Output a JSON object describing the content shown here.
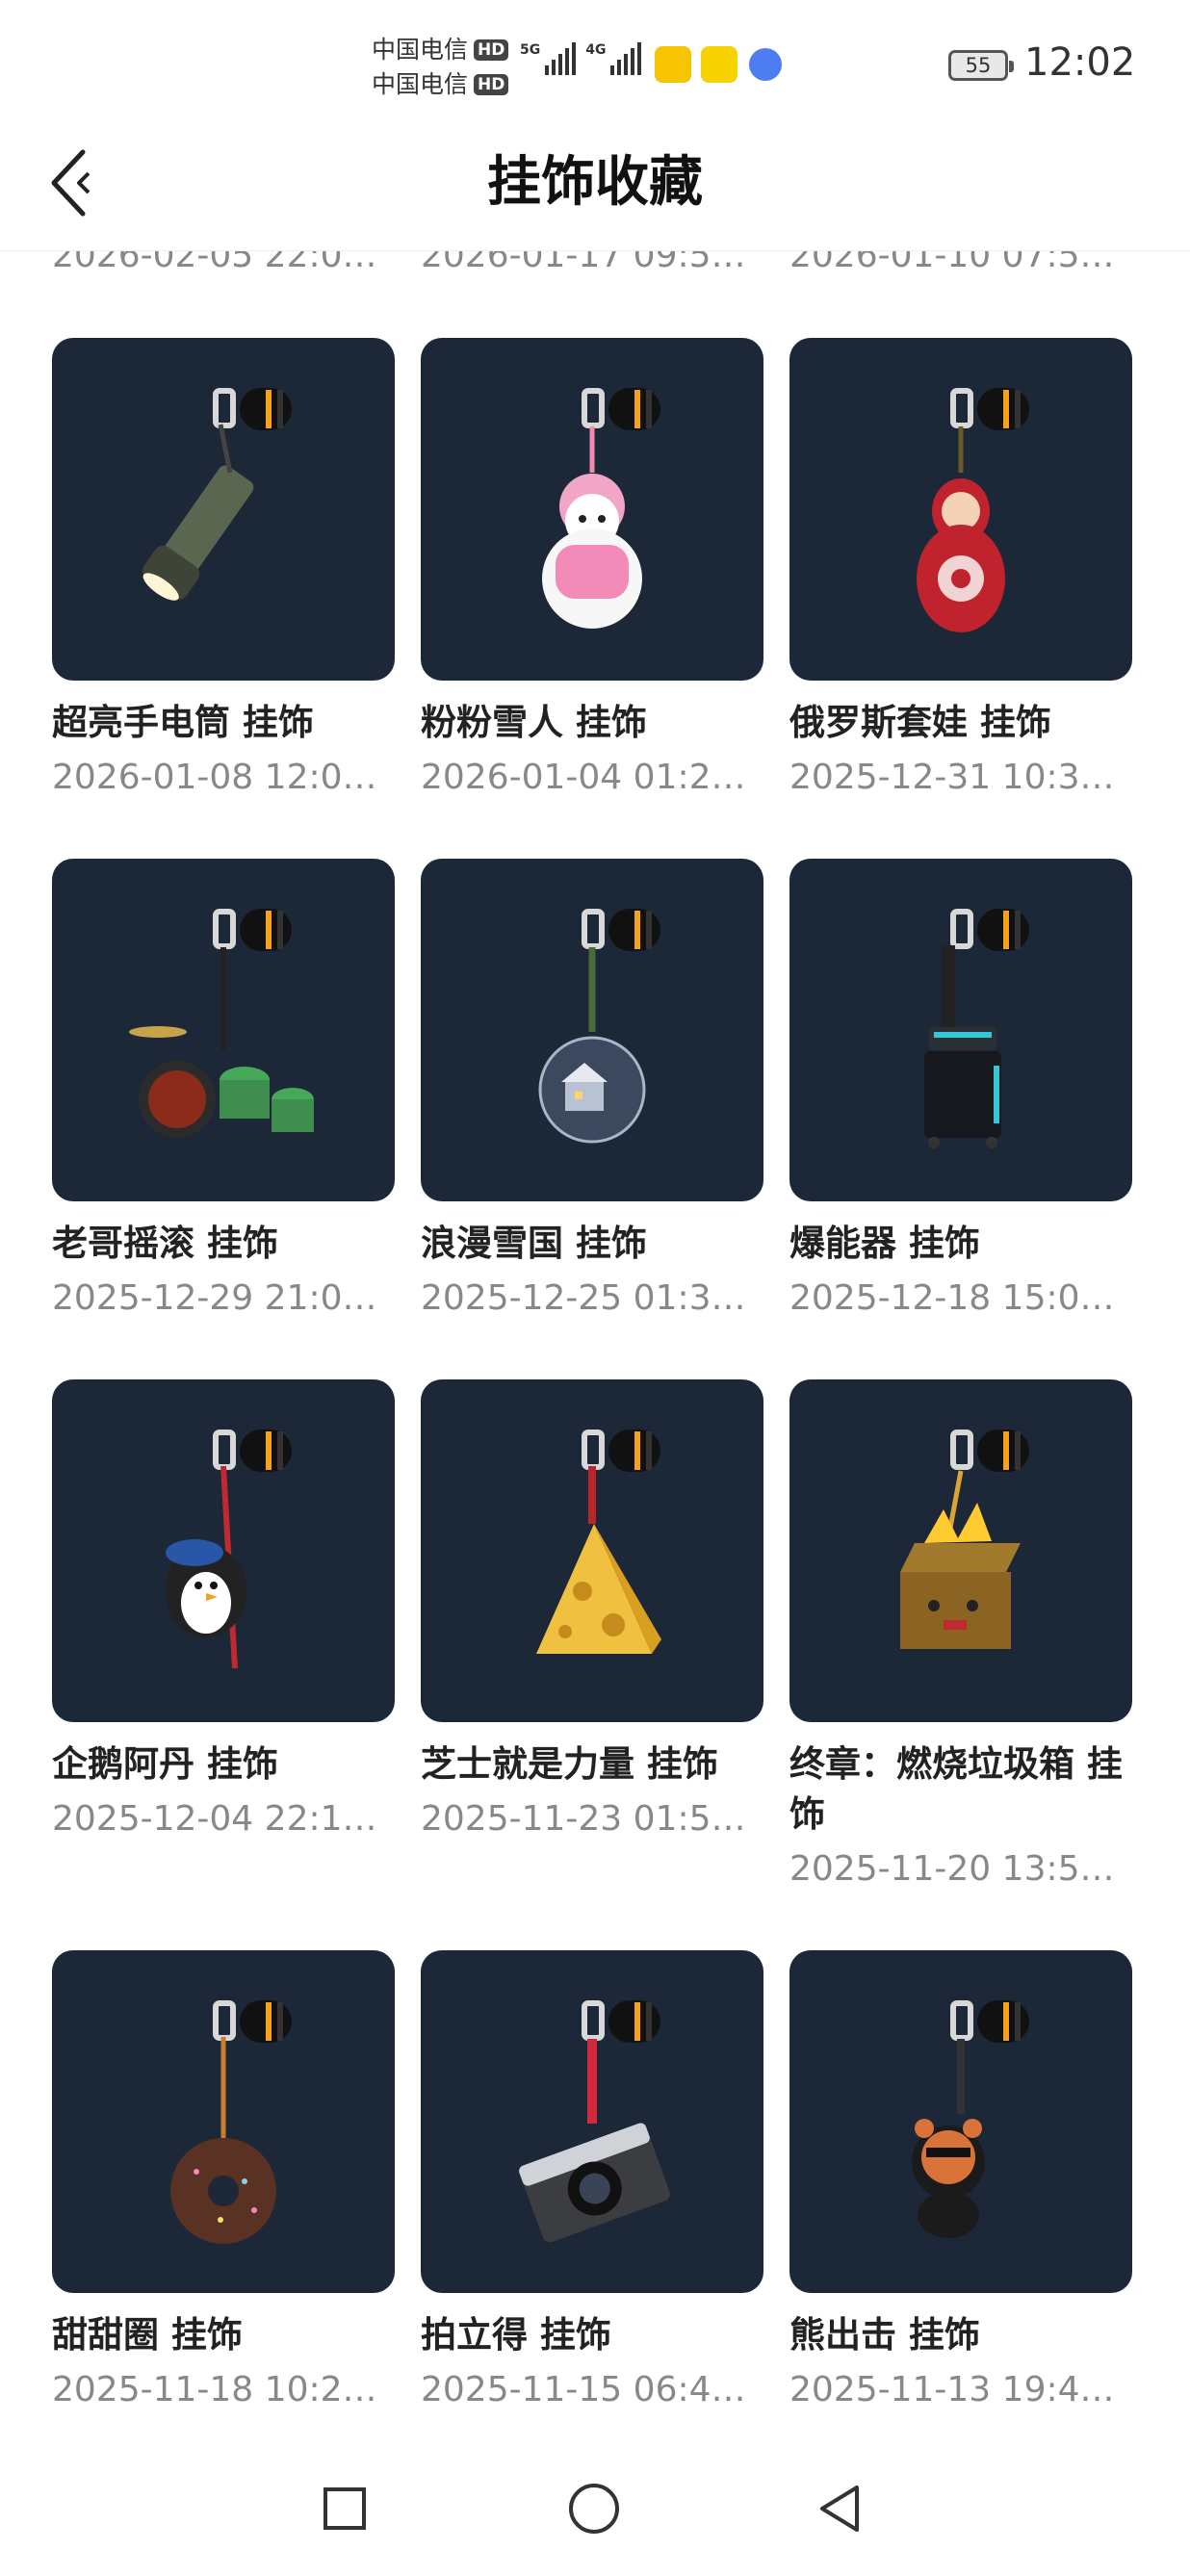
{
  "status_bar": {
    "carrier_1": "中国电信",
    "carrier_2": "中国电信",
    "hd_label": "HD",
    "signal_1_tag": "5G",
    "signal_2_tag": "4G",
    "battery": "55",
    "time": "12:02"
  },
  "header": {
    "title": "挂饰收藏"
  },
  "partial_row_dates": [
    "2026-02-05 22:06...",
    "2026-01-17 09:52...",
    "2026-01-10 07:51..."
  ],
  "items": [
    {
      "name": "超亮手电筒 挂饰",
      "date": "2026-01-08 12:00...",
      "icon": "flashlight-charm-icon"
    },
    {
      "name": "粉粉雪人 挂饰",
      "date": "2026-01-04 01:20...",
      "icon": "snowman-charm-icon"
    },
    {
      "name": "俄罗斯套娃 挂饰",
      "date": "2025-12-31 10:33...",
      "icon": "matryoshka-charm-icon"
    },
    {
      "name": "老哥摇滚 挂饰",
      "date": "2025-12-29 21:02...",
      "icon": "drumkit-charm-icon"
    },
    {
      "name": "浪漫雪国 挂饰",
      "date": "2025-12-25 01:38...",
      "icon": "snowglobe-charm-icon"
    },
    {
      "name": "爆能器 挂饰",
      "date": "2025-12-18 15:00...",
      "icon": "blaster-charm-icon"
    },
    {
      "name": "企鹅阿丹 挂饰",
      "date": "2025-12-04 22:11...",
      "icon": "penguin-charm-icon"
    },
    {
      "name": "芝士就是力量 挂饰",
      "date": "2025-11-23 01:50...",
      "icon": "cheese-charm-icon"
    },
    {
      "name": "终章：燃烧垃圾箱 挂饰",
      "date": "2025-11-20 13:50...",
      "icon": "burning-box-charm-icon"
    },
    {
      "name": "甜甜圈 挂饰",
      "date": "2025-11-18 10:26...",
      "icon": "donut-charm-icon"
    },
    {
      "name": "拍立得 挂饰",
      "date": "2025-11-15 06:40...",
      "icon": "camera-charm-icon"
    },
    {
      "name": "熊出击 挂饰",
      "date": "2025-11-13 19:42...",
      "icon": "bear-charm-icon"
    }
  ],
  "colors": {
    "card_bg": "#1c2737",
    "accent_orange": "#f5a21b"
  }
}
